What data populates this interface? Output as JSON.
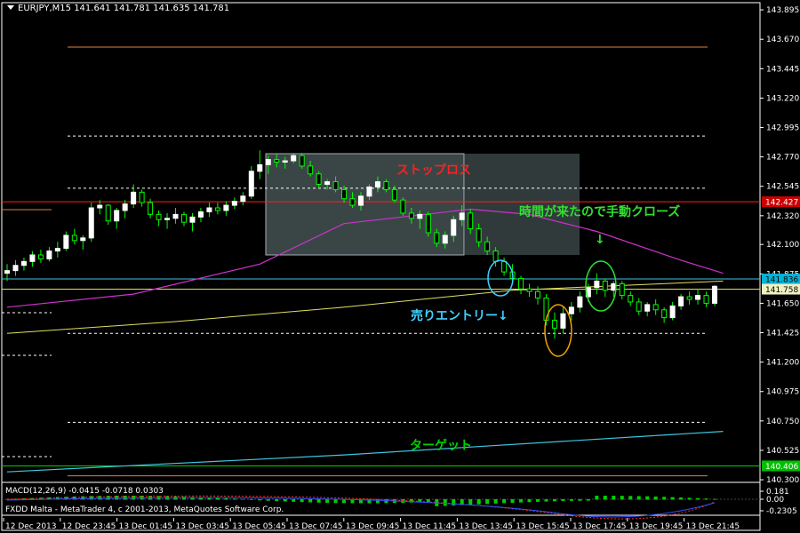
{
  "header": {
    "symbol": "EURJPY,M15",
    "ohlc": "141.641 141.781 141.635 141.781"
  },
  "macd": {
    "label": "MACD(12,26,9) -0.0415 -0.0718 0.0303",
    "ticks": [
      "0.181",
      "0.00",
      "-0.2305"
    ]
  },
  "footer": {
    "broker": "FXDD Malta - MetaTrader 4, c 2001-2013, MetaQuotes Software Corp."
  },
  "price_axis": {
    "ticks": [
      "143.895",
      "143.670",
      "143.445",
      "143.220",
      "142.995",
      "142.770",
      "142.545",
      "142.320",
      "142.100",
      "141.875",
      "141.650",
      "141.425",
      "141.200",
      "140.975",
      "140.750",
      "140.525",
      "140.300"
    ],
    "badges": [
      {
        "text": "142.427",
        "bg": "#cc0000",
        "fg": "#ffffff"
      },
      {
        "text": "141.836",
        "bg": "#00b4d8",
        "fg": "#000000"
      },
      {
        "text": "141.758",
        "bg": "#f0f0c0",
        "fg": "#000000"
      },
      {
        "text": "140.406",
        "bg": "#00c000",
        "fg": "#ffffff"
      }
    ]
  },
  "time_axis": [
    "12 Dec 2013",
    "12 Dec 23:45",
    "13 Dec 01:45",
    "13 Dec 03:45",
    "13 Dec 05:45",
    "13 Dec 07:45",
    "13 Dec 09:45",
    "13 Dec 11:45",
    "13 Dec 13:45",
    "13 Dec 15:45",
    "13 Dec 17:45",
    "13 Dec 19:45",
    "13 Dec 21:45"
  ],
  "annotations": {
    "stop_loss": "ストップロス",
    "manual_close": "時間が来たので手動クローズ",
    "arrow_down": "↓",
    "sell_entry": "売りエントリー↓",
    "target": "ターゲット"
  },
  "colors": {
    "background": "#000000",
    "grid_line": "#ffffff",
    "bull_candle": "#ffffff",
    "bear_candle": "#000000",
    "wick": "#00ff00",
    "ma_magenta": "#cc33cc",
    "ma_yellow": "#e0e060",
    "trend_cyan": "#3ec6e0",
    "stop_red": "#ff2020",
    "target_green": "#00d000",
    "entry_cyan": "#40d0ff",
    "close_green": "#30e030",
    "circle_orange": "#f0a000",
    "orange_line": "#e08040",
    "stop_box": "#6a8080"
  },
  "chart_data": {
    "type": "candlestick",
    "instrument": "EURJPY",
    "timeframe": "M15",
    "ylim": [
      140.28,
      143.95
    ],
    "levels": [
      {
        "name": "orange-top",
        "value": 143.61
      },
      {
        "name": "dotted",
        "value": 142.93
      },
      {
        "name": "dotted",
        "value": 142.53
      },
      {
        "name": "stop-loss-red",
        "value": 142.427
      },
      {
        "name": "entry-cyan",
        "value": 141.836
      },
      {
        "name": "entry-yellow",
        "value": 141.758
      },
      {
        "name": "dotted",
        "value": 141.42
      },
      {
        "name": "dotted",
        "value": 140.74
      },
      {
        "name": "target-green",
        "value": 140.406
      },
      {
        "name": "orange-bottom",
        "value": 140.33
      }
    ],
    "candles": [
      [
        141.88,
        141.95,
        141.82,
        141.9
      ],
      [
        141.9,
        141.98,
        141.86,
        141.94
      ],
      [
        141.94,
        142.0,
        141.9,
        141.97
      ],
      [
        141.97,
        142.05,
        141.93,
        142.02
      ],
      [
        142.02,
        142.06,
        141.96,
        141.99
      ],
      [
        141.99,
        142.08,
        141.97,
        142.05
      ],
      [
        142.05,
        142.12,
        142.0,
        142.07
      ],
      [
        142.07,
        142.2,
        142.05,
        142.17
      ],
      [
        142.17,
        142.22,
        142.1,
        142.13
      ],
      [
        142.13,
        142.17,
        142.06,
        142.15
      ],
      [
        142.15,
        142.42,
        142.12,
        142.38
      ],
      [
        142.38,
        142.44,
        142.33,
        142.4
      ],
      [
        142.4,
        142.41,
        142.25,
        142.28
      ],
      [
        142.28,
        142.38,
        142.22,
        142.36
      ],
      [
        142.36,
        142.44,
        142.3,
        142.41
      ],
      [
        142.41,
        142.56,
        142.38,
        142.5
      ],
      [
        142.5,
        142.52,
        142.39,
        142.42
      ],
      [
        142.42,
        142.45,
        142.3,
        142.33
      ],
      [
        142.33,
        142.36,
        142.24,
        142.29
      ],
      [
        142.29,
        142.34,
        142.22,
        142.3
      ],
      [
        142.3,
        142.38,
        142.26,
        142.33
      ],
      [
        142.33,
        142.35,
        142.24,
        142.27
      ],
      [
        142.27,
        142.34,
        142.2,
        142.31
      ],
      [
        142.31,
        142.38,
        142.27,
        142.35
      ],
      [
        142.35,
        142.42,
        142.31,
        142.38
      ],
      [
        142.38,
        142.42,
        142.33,
        142.36
      ],
      [
        142.36,
        142.43,
        142.32,
        142.4
      ],
      [
        142.4,
        142.46,
        142.37,
        142.43
      ],
      [
        142.43,
        142.5,
        142.4,
        142.47
      ],
      [
        142.47,
        142.7,
        142.45,
        142.66
      ],
      [
        142.66,
        142.82,
        142.6,
        142.71
      ],
      [
        142.71,
        142.78,
        142.64,
        142.75
      ],
      [
        142.75,
        142.79,
        142.69,
        142.73
      ],
      [
        142.73,
        142.77,
        142.68,
        142.74
      ],
      [
        142.74,
        142.8,
        142.72,
        142.78
      ],
      [
        142.78,
        142.8,
        142.68,
        142.7
      ],
      [
        142.7,
        142.74,
        142.62,
        142.64
      ],
      [
        142.64,
        142.66,
        142.54,
        142.56
      ],
      [
        142.56,
        142.6,
        142.52,
        142.58
      ],
      [
        142.58,
        142.62,
        142.5,
        142.52
      ],
      [
        142.52,
        142.55,
        142.42,
        142.45
      ],
      [
        142.45,
        142.5,
        142.38,
        142.4
      ],
      [
        142.4,
        142.5,
        142.36,
        142.47
      ],
      [
        142.47,
        142.56,
        142.44,
        142.54
      ],
      [
        142.54,
        142.62,
        142.5,
        142.58
      ],
      [
        142.58,
        142.6,
        142.5,
        142.52
      ],
      [
        142.52,
        142.55,
        142.42,
        142.44
      ],
      [
        142.44,
        142.46,
        142.32,
        142.34
      ],
      [
        142.34,
        142.38,
        142.26,
        142.3
      ],
      [
        142.3,
        142.36,
        142.22,
        142.33
      ],
      [
        142.33,
        142.35,
        142.16,
        142.19
      ],
      [
        142.19,
        142.22,
        142.08,
        142.11
      ],
      [
        142.11,
        142.2,
        142.07,
        142.17
      ],
      [
        142.17,
        142.32,
        142.12,
        142.29
      ],
      [
        142.29,
        142.4,
        142.24,
        142.34
      ],
      [
        142.34,
        142.37,
        142.18,
        142.22
      ],
      [
        142.22,
        142.26,
        142.08,
        142.12
      ],
      [
        142.12,
        142.16,
        142.02,
        142.05
      ],
      [
        142.05,
        142.08,
        141.93,
        141.97
      ],
      [
        141.97,
        142.0,
        141.86,
        141.89
      ],
      [
        141.89,
        141.95,
        141.8,
        141.84
      ],
      [
        141.84,
        141.86,
        141.72,
        141.76
      ],
      [
        141.76,
        141.8,
        141.7,
        141.74
      ],
      [
        141.74,
        141.78,
        141.64,
        141.69
      ],
      [
        141.69,
        141.72,
        141.48,
        141.52
      ],
      [
        141.52,
        141.58,
        141.38,
        141.46
      ],
      [
        141.46,
        141.62,
        141.42,
        141.57
      ],
      [
        141.57,
        141.66,
        141.52,
        141.62
      ],
      [
        141.62,
        141.74,
        141.58,
        141.7
      ],
      [
        141.7,
        141.8,
        141.66,
        141.77
      ],
      [
        141.77,
        141.88,
        141.72,
        141.82
      ],
      [
        141.82,
        141.84,
        141.7,
        141.75
      ],
      [
        141.75,
        141.82,
        141.7,
        141.8
      ],
      [
        141.8,
        141.82,
        141.68,
        141.71
      ],
      [
        141.71,
        141.74,
        141.63,
        141.66
      ],
      [
        141.66,
        141.69,
        141.56,
        141.59
      ],
      [
        141.59,
        141.66,
        141.55,
        141.64
      ],
      [
        141.64,
        141.68,
        141.56,
        141.6
      ],
      [
        141.6,
        141.62,
        141.5,
        141.54
      ],
      [
        141.54,
        141.66,
        141.52,
        141.63
      ],
      [
        141.63,
        141.72,
        141.6,
        141.7
      ],
      [
        141.7,
        141.74,
        141.64,
        141.68
      ],
      [
        141.68,
        141.76,
        141.64,
        141.71
      ],
      [
        141.71,
        141.74,
        141.62,
        141.65
      ],
      [
        141.65,
        141.79,
        141.63,
        141.78
      ]
    ],
    "moving_average_magenta": [
      [
        0,
        141.62
      ],
      [
        15,
        141.72
      ],
      [
        30,
        141.95
      ],
      [
        40,
        142.26
      ],
      [
        55,
        142.37
      ],
      [
        62,
        142.33
      ],
      [
        70,
        142.2
      ],
      [
        80,
        141.98
      ],
      [
        85,
        141.88
      ]
    ],
    "moving_average_yellow": [
      [
        0,
        141.42
      ],
      [
        20,
        141.51
      ],
      [
        40,
        141.62
      ],
      [
        60,
        141.75
      ],
      [
        85,
        141.82
      ]
    ],
    "trend_line_cyan": [
      [
        0,
        140.36
      ],
      [
        40,
        140.49
      ],
      [
        85,
        140.67
      ]
    ]
  }
}
